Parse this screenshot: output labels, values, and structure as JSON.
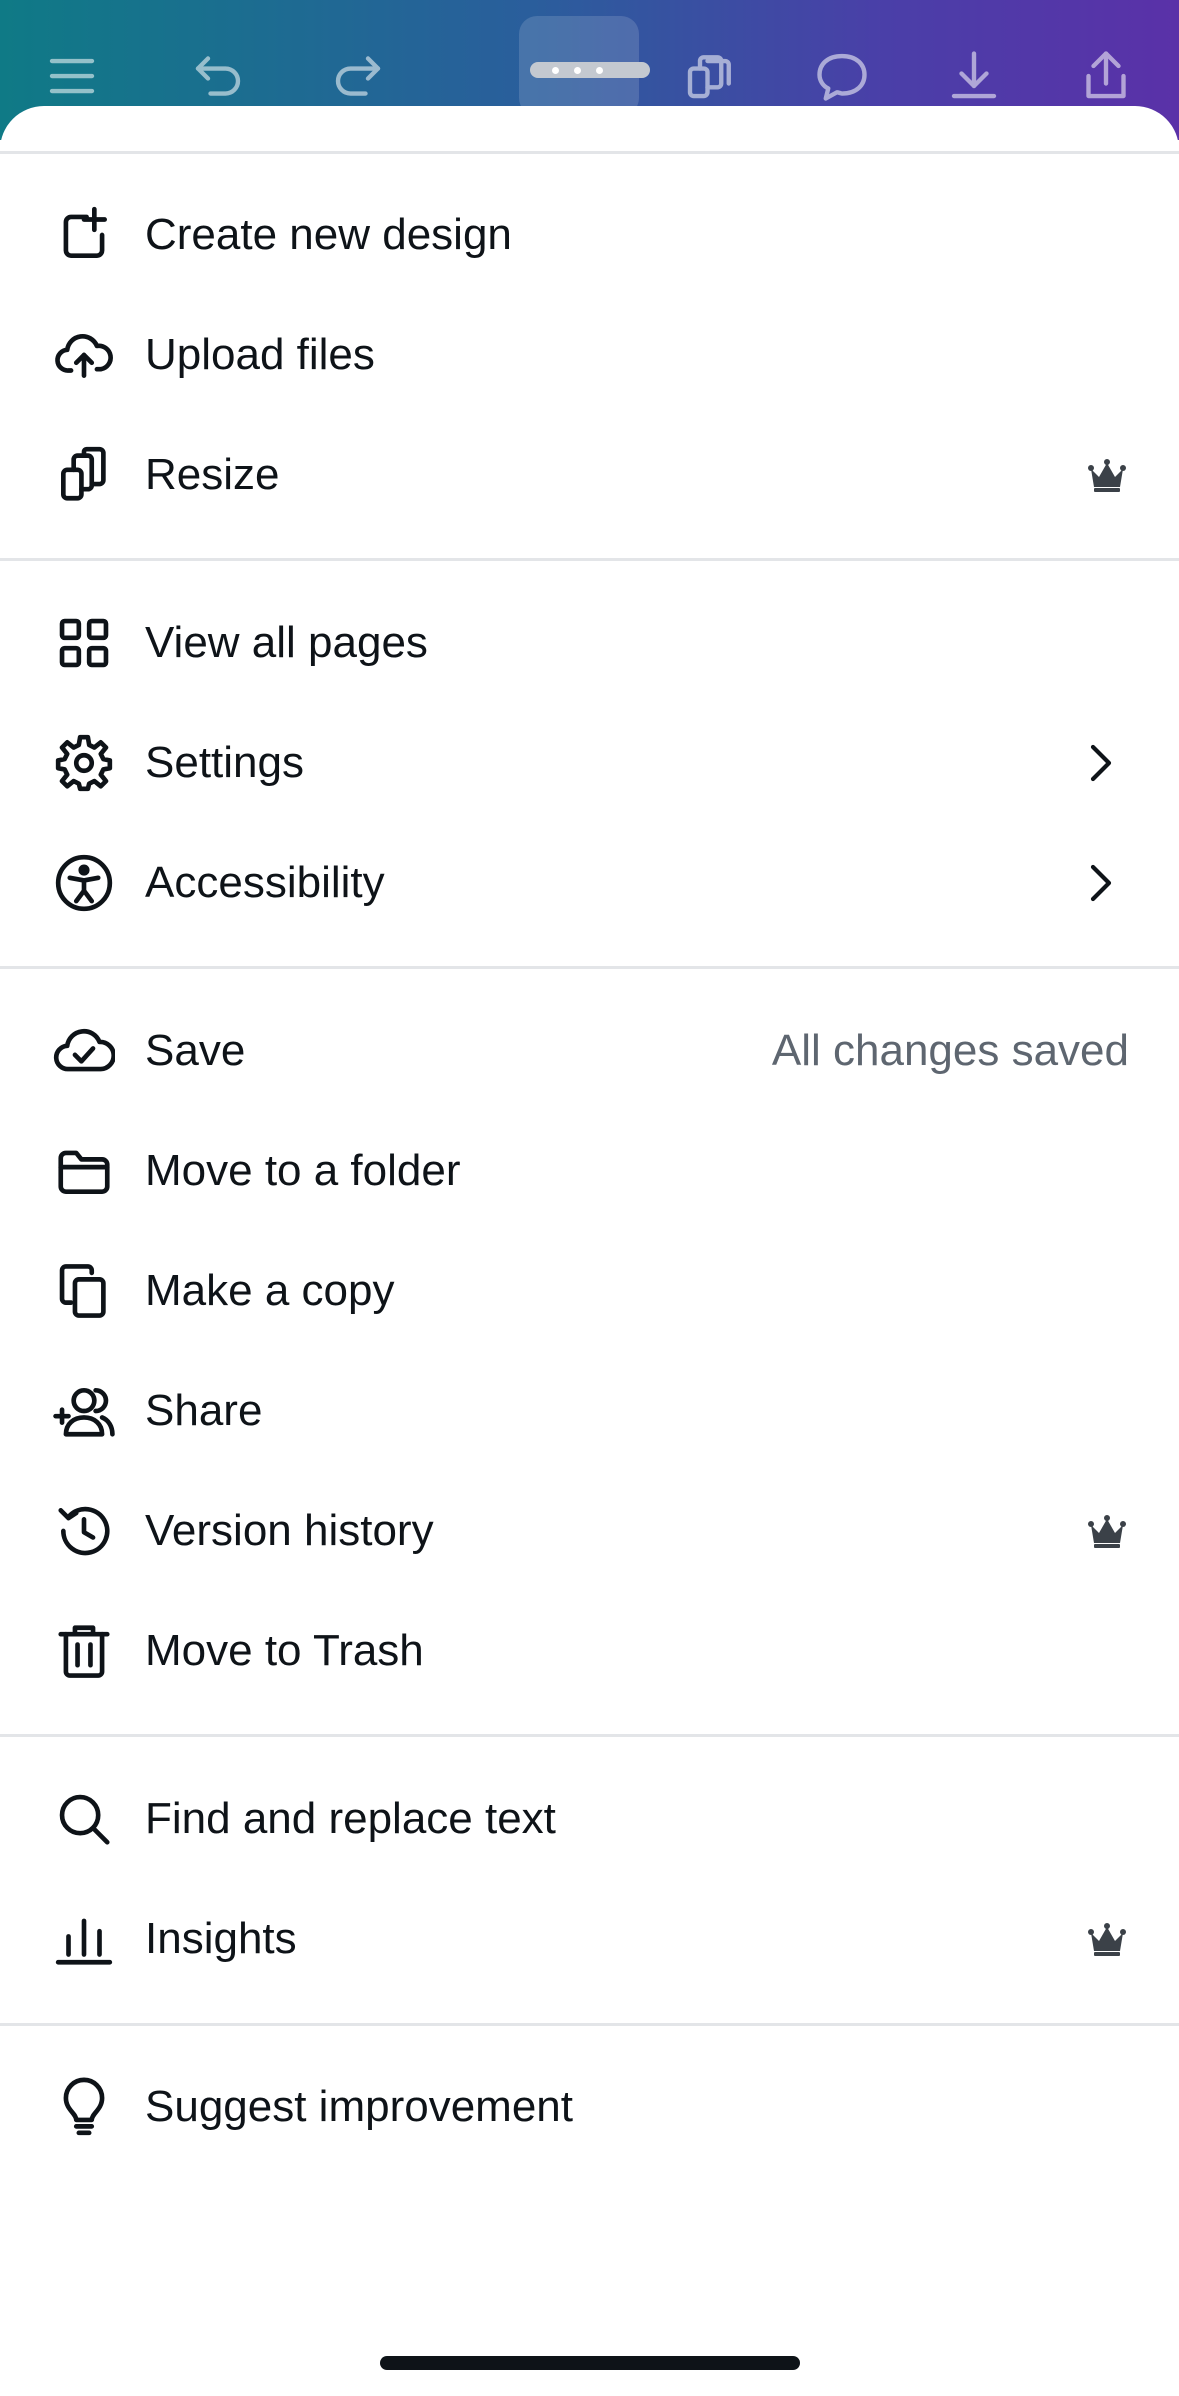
{
  "menu": {
    "create_new_design": "Create new design",
    "upload_files": "Upload files",
    "resize": "Resize",
    "view_all_pages": "View all pages",
    "settings": "Settings",
    "accessibility": "Accessibility",
    "save": "Save",
    "save_status": "All changes saved",
    "move_to_folder": "Move to a folder",
    "make_copy": "Make a copy",
    "share": "Share",
    "version_history": "Version history",
    "move_to_trash": "Move to Trash",
    "find_replace": "Find and replace text",
    "insights": "Insights",
    "suggest_improvement": "Suggest improvement"
  },
  "icons": {
    "toolbar": [
      "menu-icon",
      "undo-icon",
      "redo-icon",
      "more-icon",
      "resize-icon",
      "comment-icon",
      "download-icon",
      "share-icon"
    ],
    "premium": "crown-icon"
  },
  "colors": {
    "gradient_start": "#0f7a86",
    "gradient_end": "#5a31a8",
    "text": "#0e1318",
    "muted_text": "#5e6670",
    "divider": "#e3e5e8"
  }
}
